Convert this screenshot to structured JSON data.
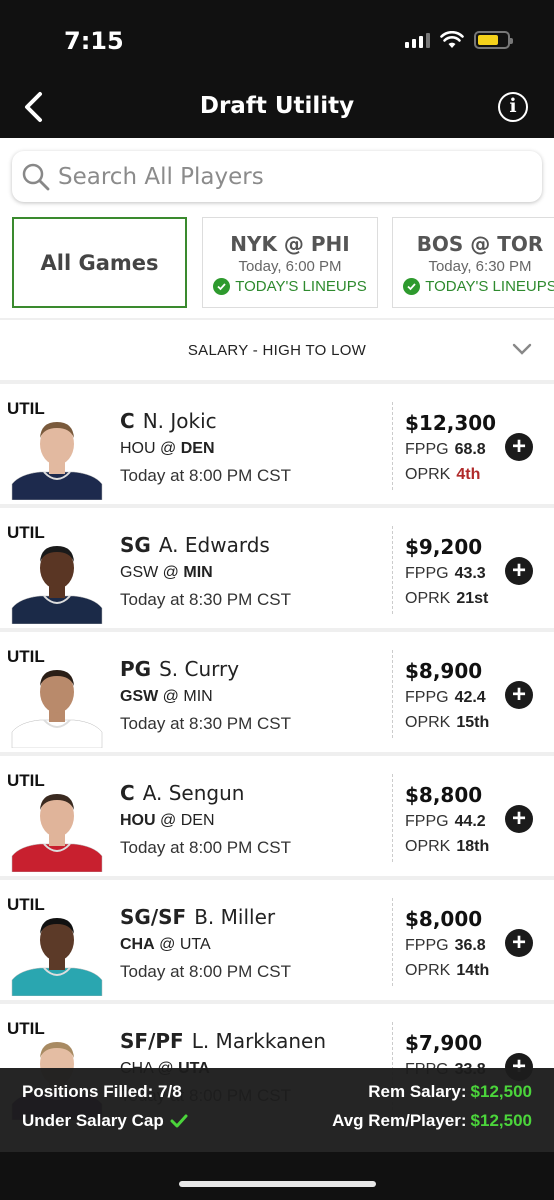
{
  "status": {
    "time": "7:15"
  },
  "header": {
    "title": "Draft Utility"
  },
  "search": {
    "placeholder": "Search All Players"
  },
  "games": {
    "all_label": "All Games",
    "items": [
      {
        "matchup": "NYK @ PHI",
        "time": "Today, 6:00 PM",
        "lineups": "TODAY'S LINEUPS"
      },
      {
        "matchup": "BOS @ TOR",
        "time": "Today, 6:30 PM",
        "lineups": "TODAY'S LINEUPS"
      }
    ]
  },
  "sort": {
    "label": "SALARY - HIGH TO LOW"
  },
  "fppg_label": "FPPG",
  "oprk_label": "OPRK",
  "players": [
    {
      "slot": "UTIL",
      "pos": "C",
      "name": "N. Jokic",
      "team": "HOU",
      "at": "@",
      "opp": "DEN",
      "bold": "opp",
      "time": "Today at 8:00 PM CST",
      "salary": "$12,300",
      "fppg": "68.8",
      "oprk": "4th",
      "oprk_bad": true,
      "jersey": "#1d2a4d",
      "skin": "#e2b9a0",
      "hair": "#7a5a3c"
    },
    {
      "slot": "UTIL",
      "pos": "SG",
      "name": "A. Edwards",
      "team": "GSW",
      "at": "@",
      "opp": "MIN",
      "bold": "opp",
      "time": "Today at 8:30 PM CST",
      "salary": "$9,200",
      "fppg": "43.3",
      "oprk": "21st",
      "oprk_bad": false,
      "jersey": "#1b2a48",
      "skin": "#5a3624",
      "hair": "#1a1a1a"
    },
    {
      "slot": "UTIL",
      "pos": "PG",
      "name": "S. Curry",
      "team": "GSW",
      "at": "@",
      "opp": "MIN",
      "bold": "team",
      "time": "Today at 8:30 PM CST",
      "salary": "$8,900",
      "fppg": "42.4",
      "oprk": "15th",
      "oprk_bad": false,
      "jersey": "#ffffff",
      "skin": "#b98a6b",
      "hair": "#2a1e16"
    },
    {
      "slot": "UTIL",
      "pos": "C",
      "name": "A. Sengun",
      "team": "HOU",
      "at": "@",
      "opp": "DEN",
      "bold": "team",
      "time": "Today at 8:00 PM CST",
      "salary": "$8,800",
      "fppg": "44.2",
      "oprk": "18th",
      "oprk_bad": false,
      "jersey": "#c8202f",
      "skin": "#e0b49a",
      "hair": "#3a2a20"
    },
    {
      "slot": "UTIL",
      "pos": "SG/SF",
      "name": "B. Miller",
      "team": "CHA",
      "at": "@",
      "opp": "UTA",
      "bold": "team",
      "time": "Today at 8:00 PM CST",
      "salary": "$8,000",
      "fppg": "36.8",
      "oprk": "14th",
      "oprk_bad": false,
      "jersey": "#2aa6b0",
      "skin": "#5c3a28",
      "hair": "#111111"
    },
    {
      "slot": "UTIL",
      "pos": "SF/PF",
      "name": "L. Markkanen",
      "team": "CHA",
      "at": "@",
      "opp": "UTA",
      "bold": "opp",
      "time": "Today at 8:00 PM CST",
      "salary": "$7,900",
      "fppg": "33.8",
      "oprk": "",
      "oprk_bad": false,
      "jersey": "#5a2a86",
      "skin": "#e4bda3",
      "hair": "#a88a62"
    }
  ],
  "footer": {
    "positions_label": "Positions Filled:",
    "positions_value": "7/8",
    "under_cap_label": "Under Salary Cap",
    "rem_salary_label": "Rem Salary:",
    "rem_salary_value": "$12,500",
    "avg_rem_label": "Avg Rem/Player:",
    "avg_rem_value": "$12,500"
  },
  "colors": {
    "accent_green": "#3a8a2e",
    "footer_green": "#4bd43b",
    "oprk_bad": "#b02a2a"
  }
}
